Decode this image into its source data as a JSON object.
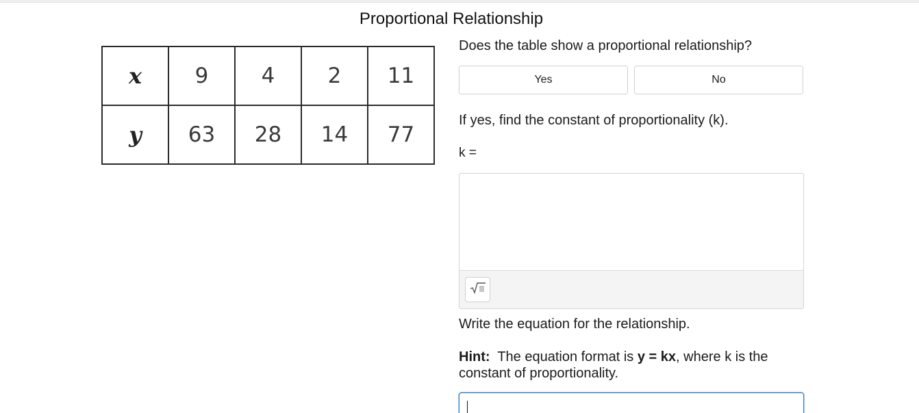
{
  "title": "Proportional Relationship",
  "table": {
    "rows": [
      {
        "label": "x",
        "values": [
          "9",
          "4",
          "2",
          "11"
        ]
      },
      {
        "label": "y",
        "values": [
          "63",
          "28",
          "14",
          "77"
        ]
      }
    ]
  },
  "question1": {
    "prompt": "Does the table show a proportional relationship?",
    "choices": {
      "yes": "Yes",
      "no": "No"
    }
  },
  "question2": {
    "prompt": "If yes, find the constant of proportionality (k).",
    "label": "k ="
  },
  "question3": {
    "prompt": "Write the equation for the relationship.",
    "hint_label": "Hint:",
    "hint_text_1": "The equation format is",
    "hint_equation": "y = kx",
    "hint_text_2": ", where k is the constant of proportionality."
  },
  "icons": {
    "math_editor": "square-root-icon"
  },
  "colors": {
    "focus_border": "#3a7bc8"
  }
}
